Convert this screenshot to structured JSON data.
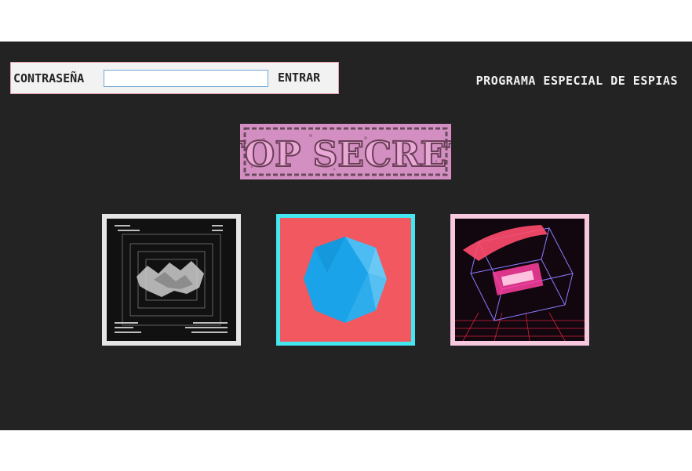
{
  "login": {
    "label": "CONTRASEÑA",
    "password_value": "",
    "submit_label": "ENTRAR"
  },
  "header": {
    "program_title": "PROGRAMA ESPECIAL DE ESPIAS"
  },
  "stamp": {
    "text": "TOP SECRET",
    "color": "#d38fc2"
  },
  "gallery": {
    "items": [
      {
        "icon": "monochrome-wireframe-art",
        "frame_color": "#e6e6e6"
      },
      {
        "icon": "blue-polyhedron-art",
        "frame_color": "#44e6f0"
      },
      {
        "icon": "neon-cube-art",
        "frame_color": "#f7c9de"
      }
    ]
  },
  "colors": {
    "background": "#232323",
    "accent_pink": "#d38fc2",
    "coral": "#f2585f"
  }
}
